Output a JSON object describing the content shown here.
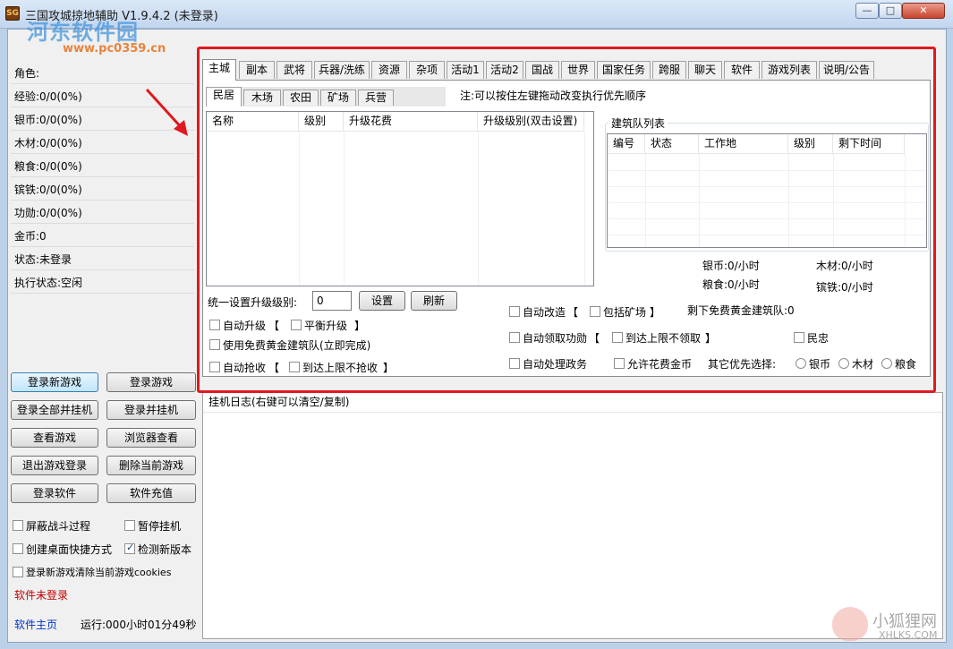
{
  "window": {
    "title": "三国攻城掠地辅助 V1.9.4.2 (未登录)",
    "minimize_glyph": "—",
    "maximize_glyph": "□",
    "close_glyph": "✕",
    "app_icon_text": "SG"
  },
  "watermarks": {
    "site_name": "河东软件园",
    "site_url": "www.pc0359.cn",
    "brand": "小狐狸网",
    "brand_url": "XHLKS.COM"
  },
  "left_panel": {
    "info": [
      "角色:",
      "经验:0/0(0%)",
      "银币:0/0(0%)",
      "木材:0/0(0%)",
      "粮食:0/0(0%)",
      "镔铁:0/0(0%)",
      "功勋:0/0(0%)",
      "金币:0",
      "状态:未登录",
      "执行状态:空闲"
    ],
    "buttons": [
      "登录新游戏",
      "登录游戏",
      "登录全部并挂机",
      "登录并挂机",
      "查看游戏",
      "浏览器查看",
      "退出游戏登录",
      "删除当前游戏",
      "登录软件",
      "软件充值"
    ],
    "checkboxes": [
      {
        "label": "屏蔽战斗过程",
        "checked": false
      },
      {
        "label": "暂停挂机",
        "checked": false
      },
      {
        "label": "创建桌面快捷方式",
        "checked": false
      },
      {
        "label": "检测新版本",
        "checked": true
      },
      {
        "label": "登录新游戏清除当前游戏cookies",
        "checked": false
      }
    ],
    "status_text": "软件未登录",
    "status_color": "#c00000",
    "homepage_link": "软件主页",
    "link_color": "#0033cc",
    "runtime": "运行:000小时01分49秒"
  },
  "main_tabs": [
    "主城",
    "副本",
    "武将",
    "兵器/洗练",
    "资源",
    "杂项",
    "活动1",
    "活动2",
    "国战",
    "世界",
    "国家任务",
    "跨服",
    "聊天",
    "软件",
    "游戏列表",
    "说明/公告"
  ],
  "sub_tabs": [
    "民居",
    "木场",
    "农田",
    "矿场",
    "兵营"
  ],
  "note": "注:可以按住左键拖动改变执行优先顺序",
  "building_list": {
    "columns": [
      "名称",
      "级别",
      "升级花费",
      "升级级别(双击设置)"
    ]
  },
  "queue": {
    "title": "建筑队列表",
    "columns": [
      "编号",
      "状态",
      "工作地",
      "级别",
      "剩下时间"
    ]
  },
  "rates": {
    "silver": "银币:0/小时",
    "wood": "木材:0/小时",
    "grain": "粮食:0/小时",
    "iron": "镔铁:0/小时"
  },
  "controls": {
    "unify_label": "统一设置升级级别:",
    "unify_value": "0",
    "set_button": "设置",
    "refresh_button": "刷新",
    "free_builders": "剩下免费黄金建筑队:0",
    "other_priority": "其它优先选择:",
    "bracket_open": "【",
    "bracket_close": "】"
  },
  "options": {
    "auto_upgrade": "自动升级",
    "balanced_upgrade": "平衡升级",
    "use_free_gold": "使用免费黄金建筑队(立即完成)",
    "auto_harvest": "自动抢收",
    "no_harvest_at_limit": "到达上限不抢收",
    "auto_rebuild": "自动改造",
    "include_mine": "包括矿场",
    "auto_merit": "自动领取功勋",
    "no_merit_at_limit": "到达上限不领取",
    "folk": "民忠",
    "auto_affairs": "自动处理政务",
    "allow_gold": "允许花费金币"
  },
  "priority_options": [
    "银币",
    "木材",
    "粮食"
  ],
  "log": {
    "header": "挂机日志(右键可以清空/复制)"
  },
  "colors": {
    "highlight_frame": "#e0191f",
    "titlebar": "#c2d6ef"
  }
}
